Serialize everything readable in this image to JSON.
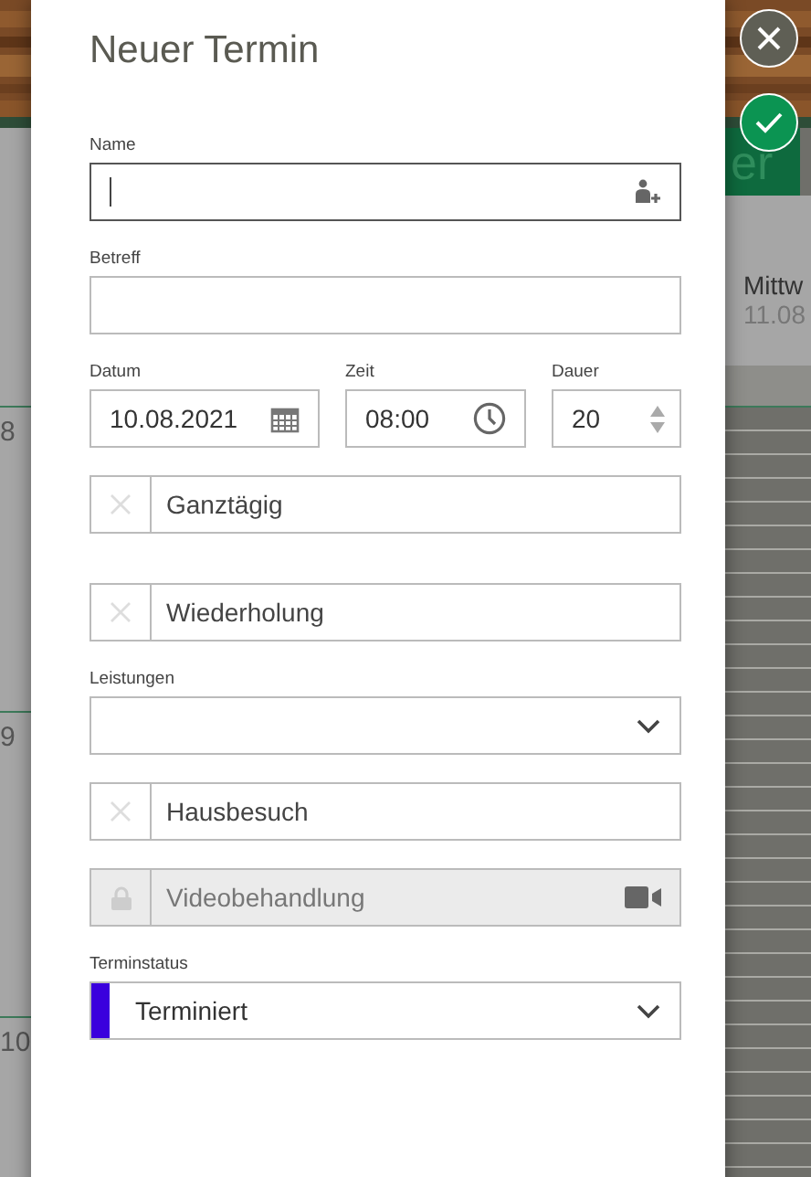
{
  "background": {
    "hours": [
      "8",
      "9",
      "10"
    ],
    "action_button": {
      "label": "er"
    },
    "day_header": {
      "weekday": "Mittw",
      "date": "11.08"
    }
  },
  "dialog": {
    "title": "Neuer Termin",
    "fields": [
      {
        "kind": "person",
        "label": "Name",
        "focused": true
      },
      {
        "kind": "text",
        "label": "Betreff",
        "focused": false
      },
      {
        "kind": "row",
        "items": [
          {
            "kind": "date",
            "label": "Datum",
            "value": "10.08.2021"
          },
          {
            "kind": "time",
            "label": "Zeit",
            "value": "08:00"
          },
          {
            "kind": "number",
            "label": "Dauer",
            "value": "20"
          }
        ]
      },
      {
        "kind": "toggle",
        "text": "Ganztägig",
        "checked": false,
        "disabled": false
      },
      {
        "kind": "toggle",
        "text": "Wiederholung",
        "checked": false,
        "disabled": false
      },
      {
        "kind": "select",
        "label": "Leistungen"
      },
      {
        "kind": "toggle",
        "text": "Hausbesuch",
        "checked": false,
        "disabled": false
      },
      {
        "kind": "video",
        "text": "Videobehandlung",
        "checked": false,
        "disabled": true
      },
      {
        "kind": "status",
        "label": "Terminstatus",
        "value": "Terminiert",
        "color": "#3a00dd"
      }
    ]
  },
  "dialog_buttons": [
    {
      "kind": "close"
    },
    {
      "kind": "confirm"
    }
  ]
}
